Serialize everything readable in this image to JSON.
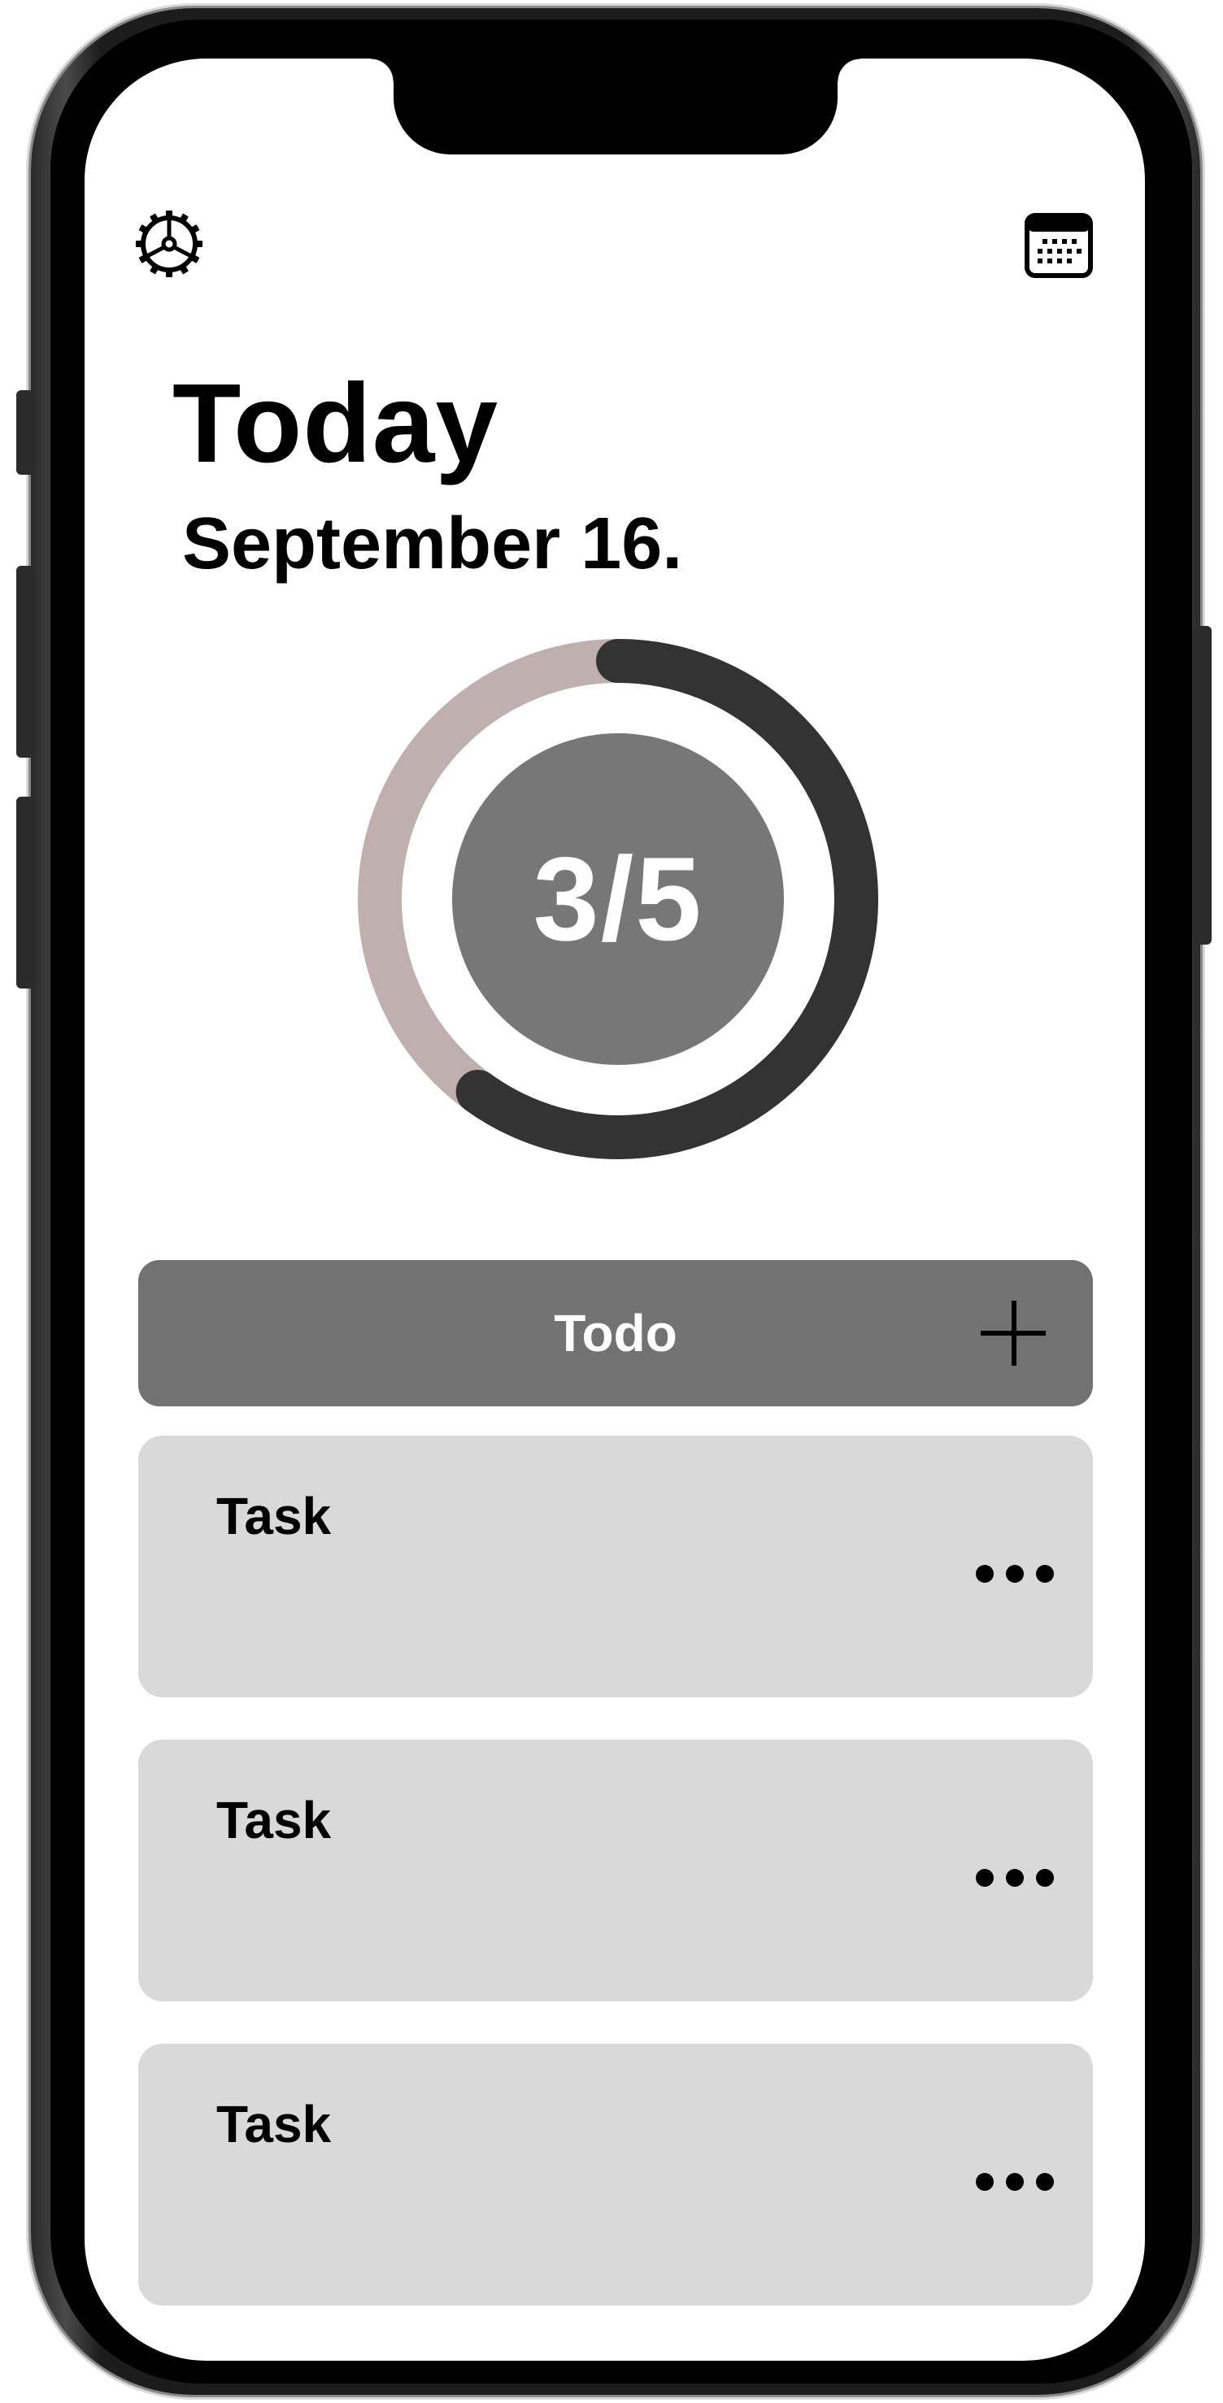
{
  "header": {
    "title": "Today",
    "date": "September 16."
  },
  "icons": {
    "settings": "gear-icon",
    "calendar": "calendar-icon",
    "add": "plus-icon",
    "more": "more-horizontal-icon"
  },
  "progress": {
    "completed": 3,
    "total": 5,
    "label": "3/5",
    "fraction": 0.6
  },
  "todo": {
    "label": "Todo"
  },
  "tasks": [
    {
      "label": "Task"
    },
    {
      "label": "Task"
    },
    {
      "label": "Task"
    }
  ],
  "colors": {
    "ring_track": "#bfafaf",
    "ring_progress": "#333333",
    "center_fill": "#777777",
    "todo_header": "#727272",
    "task_card": "#d9d9d9"
  }
}
